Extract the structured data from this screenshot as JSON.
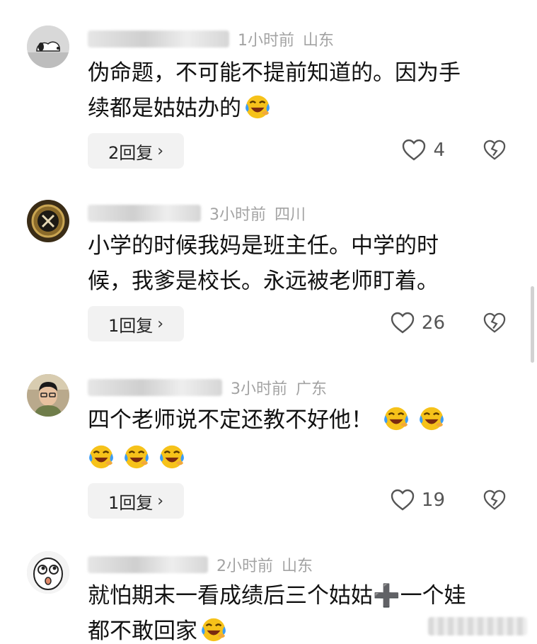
{
  "comments": [
    {
      "time": "1小时前",
      "location": "山东",
      "text_line1": "伪命题，不可能不提前知道的。因为手",
      "text_line2": "续都是姑姑办的",
      "emoji": "laughing-tears-emoji",
      "reply_label": "2回复",
      "likes": "4",
      "avatar": "snoopy-avatar"
    },
    {
      "time": "3小时前",
      "location": "四川",
      "text_line1": "小学的时候我妈是班主任。中学的时",
      "text_line2": "候，我爹是校长。永远被老师盯着。",
      "reply_label": "1回复",
      "likes": "26",
      "avatar": "ring-avatar"
    },
    {
      "time": "3小时前",
      "location": "广东",
      "text_line1": "四个老师说不定还教不好他！",
      "emoji": "laughing-tears-emoji",
      "reply_label": "1回复",
      "likes": "19",
      "avatar": "person-avatar"
    },
    {
      "time": "2小时前",
      "location": "山东",
      "text_line1": "就怕期末一看成绩后三个姑姑",
      "plus_symbol": "➕",
      "text_line1b": "一个娃",
      "text_line2": "都不敢回家",
      "emoji": "laughing-tears-emoji",
      "avatar": "cartoon-face-avatar"
    }
  ],
  "icons": {
    "chevron": "›",
    "like": "heart-icon",
    "dislike": "broken-heart-icon"
  },
  "colors": {
    "meta_gray": "#a3a3a3",
    "reply_bg": "#f2f2f2",
    "emoji_yellow": "#f6c21a",
    "emoji_tear": "#3d9df5"
  }
}
